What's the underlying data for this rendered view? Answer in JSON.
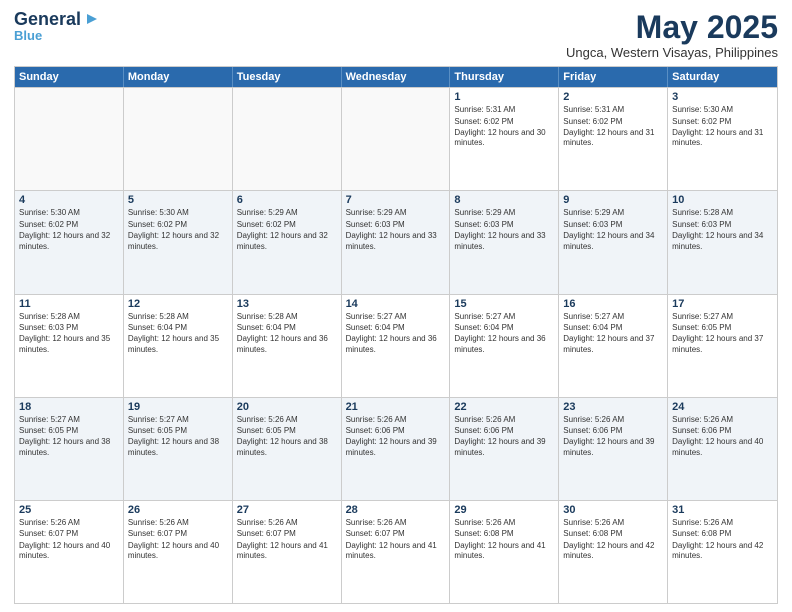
{
  "header": {
    "logo_general": "General",
    "logo_blue": "Blue",
    "month_title": "May 2025",
    "subtitle": "Ungca, Western Visayas, Philippines"
  },
  "weekdays": [
    "Sunday",
    "Monday",
    "Tuesday",
    "Wednesday",
    "Thursday",
    "Friday",
    "Saturday"
  ],
  "rows": [
    [
      {
        "day": "",
        "info": ""
      },
      {
        "day": "",
        "info": ""
      },
      {
        "day": "",
        "info": ""
      },
      {
        "day": "",
        "info": ""
      },
      {
        "day": "1",
        "info": "Sunrise: 5:31 AM\nSunset: 6:02 PM\nDaylight: 12 hours and 30 minutes."
      },
      {
        "day": "2",
        "info": "Sunrise: 5:31 AM\nSunset: 6:02 PM\nDaylight: 12 hours and 31 minutes."
      },
      {
        "day": "3",
        "info": "Sunrise: 5:30 AM\nSunset: 6:02 PM\nDaylight: 12 hours and 31 minutes."
      }
    ],
    [
      {
        "day": "4",
        "info": "Sunrise: 5:30 AM\nSunset: 6:02 PM\nDaylight: 12 hours and 32 minutes."
      },
      {
        "day": "5",
        "info": "Sunrise: 5:30 AM\nSunset: 6:02 PM\nDaylight: 12 hours and 32 minutes."
      },
      {
        "day": "6",
        "info": "Sunrise: 5:29 AM\nSunset: 6:02 PM\nDaylight: 12 hours and 32 minutes."
      },
      {
        "day": "7",
        "info": "Sunrise: 5:29 AM\nSunset: 6:03 PM\nDaylight: 12 hours and 33 minutes."
      },
      {
        "day": "8",
        "info": "Sunrise: 5:29 AM\nSunset: 6:03 PM\nDaylight: 12 hours and 33 minutes."
      },
      {
        "day": "9",
        "info": "Sunrise: 5:29 AM\nSunset: 6:03 PM\nDaylight: 12 hours and 34 minutes."
      },
      {
        "day": "10",
        "info": "Sunrise: 5:28 AM\nSunset: 6:03 PM\nDaylight: 12 hours and 34 minutes."
      }
    ],
    [
      {
        "day": "11",
        "info": "Sunrise: 5:28 AM\nSunset: 6:03 PM\nDaylight: 12 hours and 35 minutes."
      },
      {
        "day": "12",
        "info": "Sunrise: 5:28 AM\nSunset: 6:04 PM\nDaylight: 12 hours and 35 minutes."
      },
      {
        "day": "13",
        "info": "Sunrise: 5:28 AM\nSunset: 6:04 PM\nDaylight: 12 hours and 36 minutes."
      },
      {
        "day": "14",
        "info": "Sunrise: 5:27 AM\nSunset: 6:04 PM\nDaylight: 12 hours and 36 minutes."
      },
      {
        "day": "15",
        "info": "Sunrise: 5:27 AM\nSunset: 6:04 PM\nDaylight: 12 hours and 36 minutes."
      },
      {
        "day": "16",
        "info": "Sunrise: 5:27 AM\nSunset: 6:04 PM\nDaylight: 12 hours and 37 minutes."
      },
      {
        "day": "17",
        "info": "Sunrise: 5:27 AM\nSunset: 6:05 PM\nDaylight: 12 hours and 37 minutes."
      }
    ],
    [
      {
        "day": "18",
        "info": "Sunrise: 5:27 AM\nSunset: 6:05 PM\nDaylight: 12 hours and 38 minutes."
      },
      {
        "day": "19",
        "info": "Sunrise: 5:27 AM\nSunset: 6:05 PM\nDaylight: 12 hours and 38 minutes."
      },
      {
        "day": "20",
        "info": "Sunrise: 5:26 AM\nSunset: 6:05 PM\nDaylight: 12 hours and 38 minutes."
      },
      {
        "day": "21",
        "info": "Sunrise: 5:26 AM\nSunset: 6:06 PM\nDaylight: 12 hours and 39 minutes."
      },
      {
        "day": "22",
        "info": "Sunrise: 5:26 AM\nSunset: 6:06 PM\nDaylight: 12 hours and 39 minutes."
      },
      {
        "day": "23",
        "info": "Sunrise: 5:26 AM\nSunset: 6:06 PM\nDaylight: 12 hours and 39 minutes."
      },
      {
        "day": "24",
        "info": "Sunrise: 5:26 AM\nSunset: 6:06 PM\nDaylight: 12 hours and 40 minutes."
      }
    ],
    [
      {
        "day": "25",
        "info": "Sunrise: 5:26 AM\nSunset: 6:07 PM\nDaylight: 12 hours and 40 minutes."
      },
      {
        "day": "26",
        "info": "Sunrise: 5:26 AM\nSunset: 6:07 PM\nDaylight: 12 hours and 40 minutes."
      },
      {
        "day": "27",
        "info": "Sunrise: 5:26 AM\nSunset: 6:07 PM\nDaylight: 12 hours and 41 minutes."
      },
      {
        "day": "28",
        "info": "Sunrise: 5:26 AM\nSunset: 6:07 PM\nDaylight: 12 hours and 41 minutes."
      },
      {
        "day": "29",
        "info": "Sunrise: 5:26 AM\nSunset: 6:08 PM\nDaylight: 12 hours and 41 minutes."
      },
      {
        "day": "30",
        "info": "Sunrise: 5:26 AM\nSunset: 6:08 PM\nDaylight: 12 hours and 42 minutes."
      },
      {
        "day": "31",
        "info": "Sunrise: 5:26 AM\nSunset: 6:08 PM\nDaylight: 12 hours and 42 minutes."
      }
    ]
  ]
}
